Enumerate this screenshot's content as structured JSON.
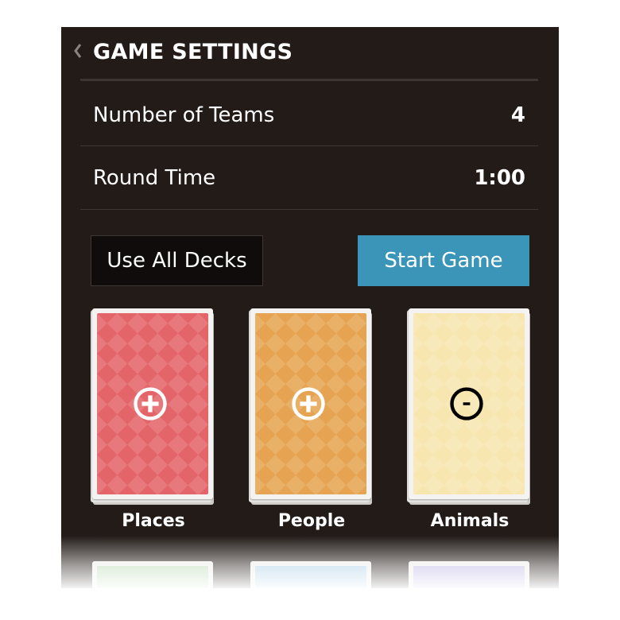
{
  "header": {
    "title": "GAME SETTINGS",
    "back_icon": "chevron-left-icon"
  },
  "settings": [
    {
      "label": "Number of Teams",
      "value": "4"
    },
    {
      "label": "Round Time",
      "value": "1:00"
    }
  ],
  "buttons": {
    "use_all_decks": "Use All Decks",
    "start_game": "Start Game"
  },
  "colors": {
    "background": "#221b18",
    "accent": "#3a95b8"
  },
  "decks": [
    {
      "name": "Places",
      "color": "#e3656a",
      "icon": "plus-circle-icon",
      "selected": false
    },
    {
      "name": "People",
      "color": "#e6a452",
      "icon": "plus-circle-icon",
      "selected": false
    },
    {
      "name": "Animals",
      "color": "#f7e6b0",
      "icon": "minus-circle-icon",
      "selected": true
    }
  ],
  "more_decks": [
    {
      "color": "#b8d9b0"
    },
    {
      "color": "#a9cde6"
    },
    {
      "color": "#b9b3e3"
    }
  ]
}
